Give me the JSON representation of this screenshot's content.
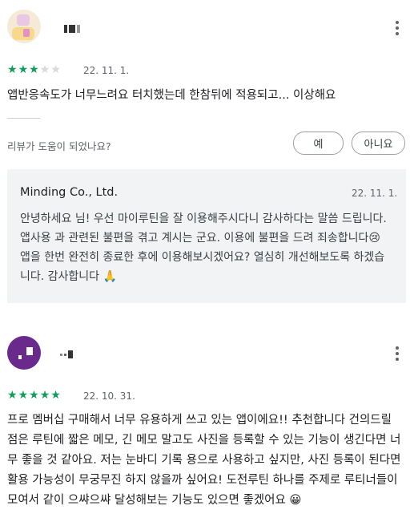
{
  "review1": {
    "author": "",
    "rating": 3,
    "max_rating": 5,
    "date": "22. 11. 1.",
    "text": "앱반응속도가 너무느려요 터치했는데 한참뒤에 적용되고... 이상해요",
    "helpful_prompt": "리뷰가 도움이 되었나요?",
    "yes_label": "예",
    "no_label": "아니요",
    "reply": {
      "developer": "Minding Co., Ltd.",
      "date": "22. 11. 1.",
      "text": "안녕하세요 님! 우선 마이루틴을 잘 이용해주시다니 감사하다는 말씀 드립니다. 앱사용 과 관련된 불편을 겪고 계시는 군요. 이용에 불편을 드려 죄송합니다😢 앱을 한번 완전히 종료한 후에 이용해보시겠어요? 열심히 개선해보도록 하겠습니다. 감사합니다 🙏"
    }
  },
  "review2": {
    "author": "",
    "rating": 5,
    "max_rating": 5,
    "date": "22. 10. 31.",
    "text": "프로 멤버십 구매해서 너무 유용하게 쓰고 있는 앱이에요!! 추천합니다 건의드릴 점은 루틴에 짧은 메모, 긴 메모 말고도 사진을 등록할 수 있는 기능이 생긴다면 너무 좋을 것 같아요. 저는 눈바디 기록 용으로 사용하고 싶지만, 사진 등록이 된다면 활용 가능성이 무궁무진 하지 않을까 싶어요! 도전루틴 하나를 주제로 루티너들이 모여서 같이 으쌰으쌰 달성해보는 기능도 있으면 좋겠어요 😀"
  },
  "icons": {
    "more": "more-vert-icon",
    "star": "star-icon"
  },
  "colors": {
    "star_filled": "#0f9d58",
    "star_empty": "#d9d9d9",
    "reply_bg": "#f1f3f4"
  }
}
